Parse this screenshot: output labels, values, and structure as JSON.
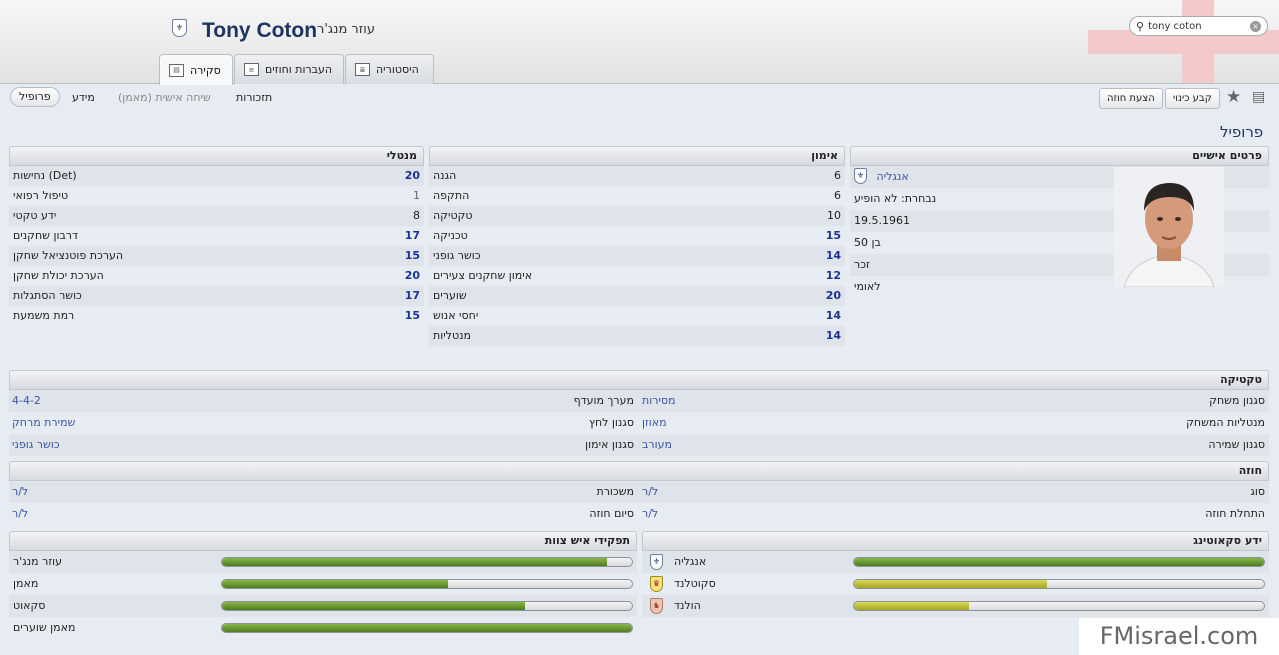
{
  "header": {
    "name": "Tony Coton",
    "role": "עוזר מנג'ר",
    "search_value": "tony coton"
  },
  "tabs": [
    {
      "label": "סקירה",
      "active": true
    },
    {
      "label": "העברות וחוזים"
    },
    {
      "label": "היסטוריה"
    }
  ],
  "subnav": {
    "profile": "פרופיל",
    "info": "מידע",
    "chat": "שיחה אישית (מאמן)",
    "reminders": "תזכורות"
  },
  "actions": {
    "propose_contract": "הצעת חוזה",
    "set_nickname": "קבע כינוי"
  },
  "section_title": "פרופיל",
  "personal": {
    "header": "פרטים אישיים",
    "nation": "אנגליה",
    "national_caps": "נבחרת: לא הופיע",
    "dob": "19.5.1961",
    "age": "בן 50",
    "gender": "זכר",
    "nationality": "לאומי"
  },
  "training": {
    "header": "אימון",
    "rows": [
      {
        "label": "הגנה",
        "value": "6",
        "level": "mid"
      },
      {
        "label": "התקפה",
        "value": "6",
        "level": "mid"
      },
      {
        "label": "טקטיקה",
        "value": "10",
        "level": "mid"
      },
      {
        "label": "טכניקה",
        "value": "15",
        "level": "high"
      },
      {
        "label": "כושר גופני",
        "value": "14",
        "level": "high"
      },
      {
        "label": "אימון שחקנים צעירים",
        "value": "12",
        "level": "high"
      },
      {
        "label": "שוערים",
        "value": "20",
        "level": "high"
      },
      {
        "label": "יחסי אנוש",
        "value": "14",
        "level": "high"
      },
      {
        "label": "מנטליות",
        "value": "14",
        "level": "high"
      }
    ]
  },
  "mental": {
    "header": "מנטלי",
    "rows": [
      {
        "label": "נחישות (Det)",
        "value": "20",
        "level": "high"
      },
      {
        "label": "טיפול רפואי",
        "value": "1",
        "level": "low"
      },
      {
        "label": "ידע טקטי",
        "value": "8",
        "level": "mid"
      },
      {
        "label": "דרבון שחקנים",
        "value": "17",
        "level": "high"
      },
      {
        "label": "הערכת פוטנציאל שחקן",
        "value": "15",
        "level": "high"
      },
      {
        "label": "הערכת יכולת שחקן",
        "value": "20",
        "level": "high"
      },
      {
        "label": "כושר הסתגלות",
        "value": "17",
        "level": "high"
      },
      {
        "label": "רמת משמעת",
        "value": "15",
        "level": "high"
      }
    ]
  },
  "tactics": {
    "header": "טקטיקה",
    "rows": [
      [
        {
          "label": "סגנון משחק",
          "value": "מסירות"
        },
        {
          "label": "מערך מועדף",
          "value": "4-4-2"
        }
      ],
      [
        {
          "label": "מנטליות המשחק",
          "value": "מאוזן"
        },
        {
          "label": "סגנון לחץ",
          "value": "שמירת מרחק"
        }
      ],
      [
        {
          "label": "סגנון שמירה",
          "value": "מעורב"
        },
        {
          "label": "סגנון אימון",
          "value": "כושר גופני"
        }
      ]
    ]
  },
  "contract": {
    "header": "חוזה",
    "rows": [
      [
        {
          "label": "סוג",
          "value": "ל/ר"
        },
        {
          "label": "משכורת",
          "value": "ל/ר"
        }
      ],
      [
        {
          "label": "התחלת חוזה",
          "value": "ל/ר"
        },
        {
          "label": "סיום חוזה",
          "value": "ל/ר"
        }
      ]
    ]
  },
  "scouting": {
    "header": "ידע סקאוטינג",
    "rows": [
      {
        "label": "אנגליה",
        "pct": 1.0,
        "color": "green",
        "icon": "england-crest-icon"
      },
      {
        "label": "סקוטלנד",
        "pct": 0.47,
        "color": "yellow",
        "icon": "scotland-crest-icon"
      },
      {
        "label": "הולנד",
        "pct": 0.28,
        "color": "yellow",
        "icon": "netherlands-crest-icon"
      }
    ]
  },
  "staff_roles": {
    "header": "תפקידי איש צוות",
    "rows": [
      {
        "label": "עוזר מנג'ר",
        "pct": 0.94
      },
      {
        "label": "מאמן",
        "pct": 0.55
      },
      {
        "label": "סקאוט",
        "pct": 0.74
      },
      {
        "label": "מאמן שוערים",
        "pct": 1.0
      }
    ]
  },
  "colors": {
    "accent": "#1c3563",
    "flag_red": "#f3c9c9",
    "value_blue": "#1a3399"
  },
  "watermark": "FMisrael.com"
}
